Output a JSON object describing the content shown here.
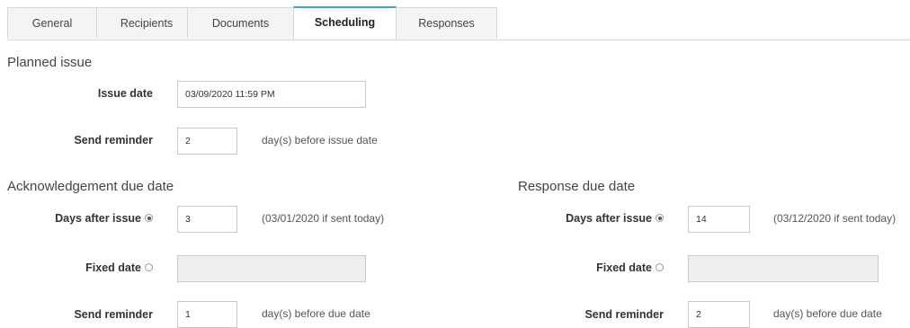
{
  "tabs": [
    {
      "label": "General"
    },
    {
      "label": "Recipients"
    },
    {
      "label": "Documents"
    },
    {
      "label": "Scheduling",
      "active": true
    },
    {
      "label": "Responses"
    }
  ],
  "planned_issue": {
    "title": "Planned issue",
    "issue_date_label": "Issue date",
    "issue_date_value": "03/09/2020 11:59 PM",
    "send_reminder_label": "Send reminder",
    "send_reminder_value": "2",
    "send_reminder_hint": "day(s) before issue date"
  },
  "acknowledgement": {
    "title": "Acknowledgement due date",
    "days_after_label": "Days after issue",
    "days_after_selected": true,
    "days_after_value": "3",
    "days_after_hint": "(03/01/2020 if sent today)",
    "fixed_date_label": "Fixed date",
    "fixed_date_selected": false,
    "fixed_date_value": "",
    "send_reminder_label": "Send reminder",
    "send_reminder_value": "1",
    "send_reminder_hint": "day(s) before due date"
  },
  "response": {
    "title": "Response due date",
    "days_after_label": "Days after issue",
    "days_after_selected": true,
    "days_after_value": "14",
    "days_after_hint": "(03/12/2020 if sent today)",
    "fixed_date_label": "Fixed date",
    "fixed_date_selected": false,
    "fixed_date_value": "",
    "send_reminder_label": "Send reminder",
    "send_reminder_value": "2",
    "send_reminder_hint": "day(s) before due date"
  }
}
